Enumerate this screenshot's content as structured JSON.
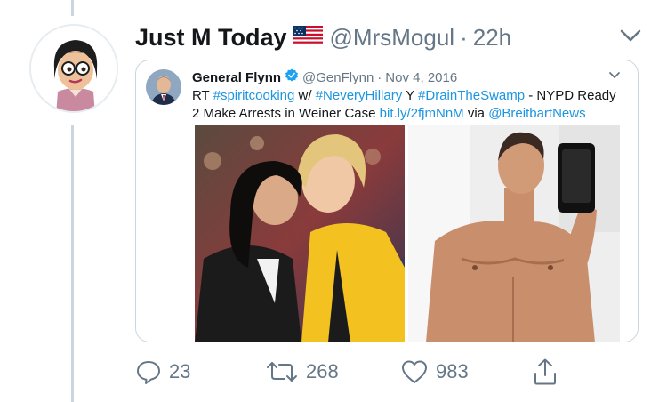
{
  "tweet": {
    "display_name": "Just M Today",
    "flag_icon": "us-flag-icon",
    "handle": "@MrsMogul",
    "separator": "·",
    "time": "22h"
  },
  "quoted_tweet": {
    "name": "General Flynn",
    "verified_icon": "verified-badge-icon",
    "handle": "@GenFlynn",
    "separator": "·",
    "date": "Nov 4, 2016",
    "text": {
      "t1": "RT ",
      "h1": "#spiritcooking",
      "t2": " w/ ",
      "h2": "#NeveryHillary",
      "t3": " Y ",
      "h3": "#DrainTheSwamp",
      "t4": " - NYPD Ready 2 Make Arrests in Weiner Case ",
      "link": "bit.ly/2fjmNnM",
      "t5": " via ",
      "mention": "@BreitbartNews"
    }
  },
  "actions": {
    "reply_count": "23",
    "retweet_count": "268",
    "like_count": "983"
  },
  "colors": {
    "link": "#1b95e0",
    "secondary_text": "#657786",
    "border": "#ccd6dd"
  }
}
